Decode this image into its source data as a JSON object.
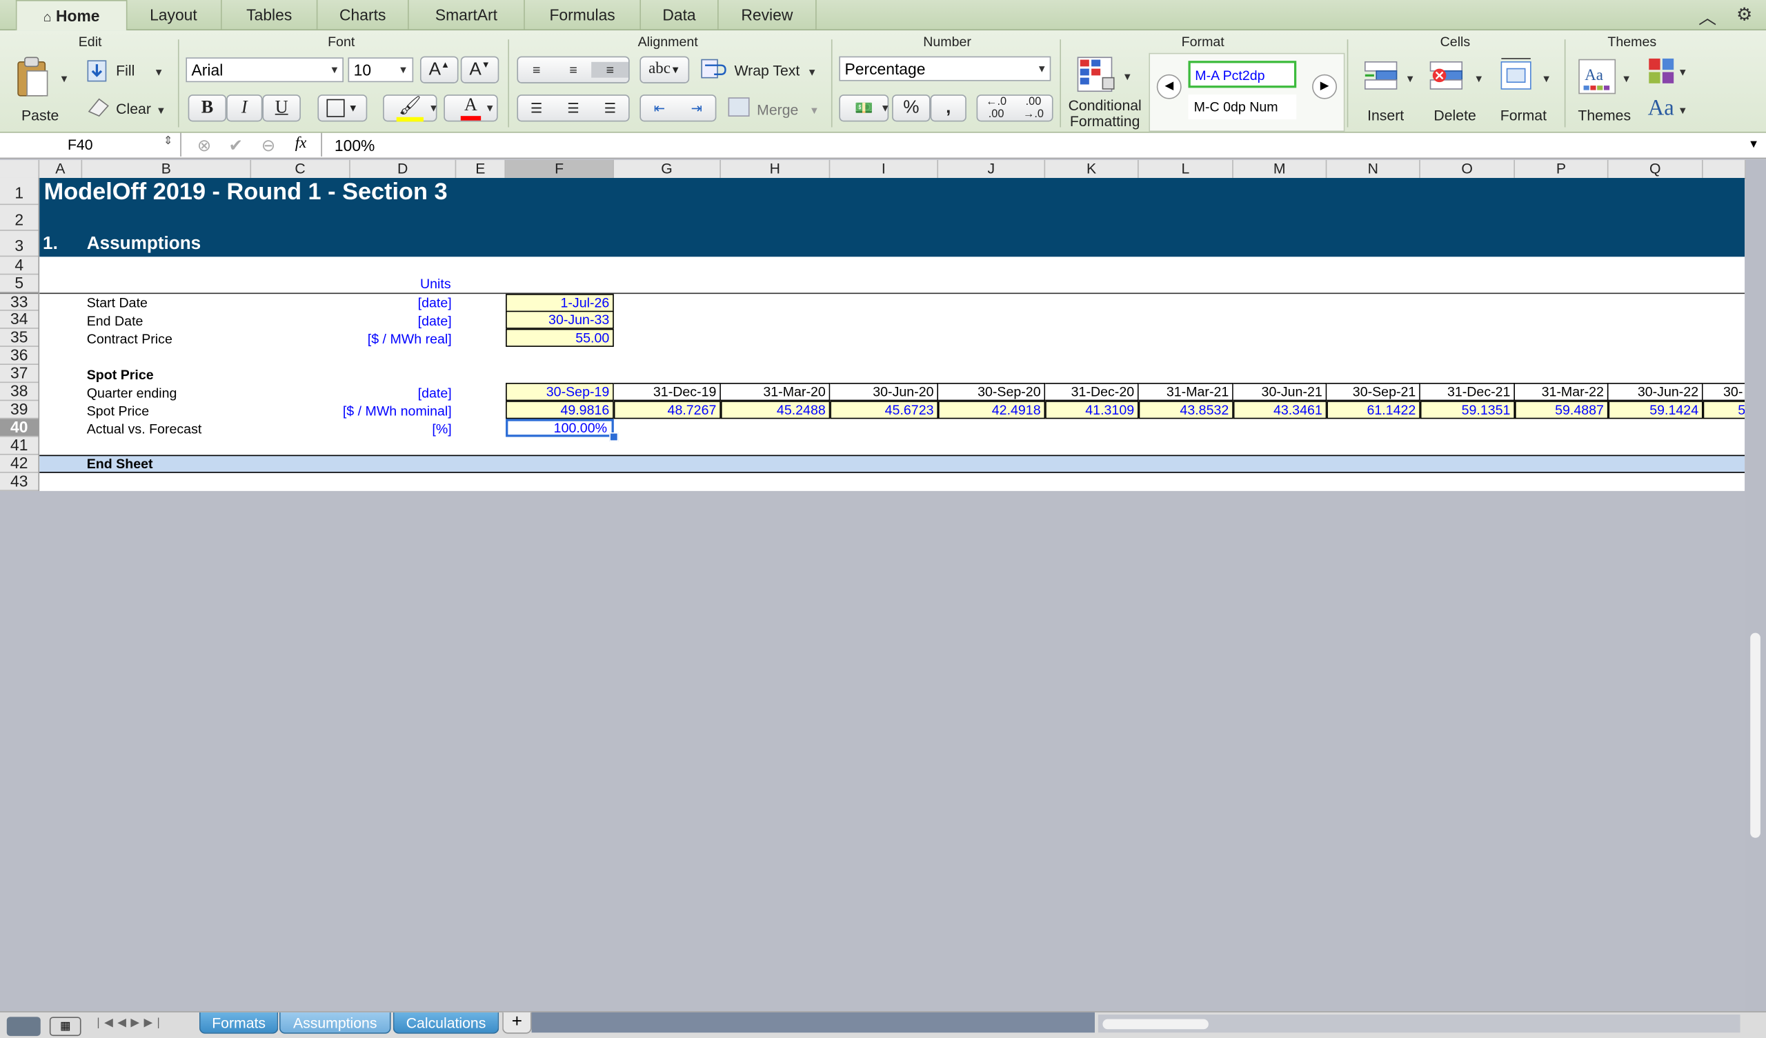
{
  "ribbon": {
    "tabs": [
      "Home",
      "Layout",
      "Tables",
      "Charts",
      "SmartArt",
      "Formulas",
      "Data",
      "Review"
    ],
    "groups": {
      "edit": {
        "title": "Edit",
        "paste": "Paste",
        "fill": "Fill",
        "clear": "Clear"
      },
      "font": {
        "title": "Font",
        "name": "Arial",
        "size": "10"
      },
      "alignment": {
        "title": "Alignment",
        "wrap": "Wrap Text",
        "merge": "Merge",
        "abc": "abc"
      },
      "number": {
        "title": "Number",
        "format": "Percentage"
      },
      "format": {
        "title": "Format",
        "conditional_line1": "Conditional",
        "conditional_line2": "Formatting",
        "style1": "M-A Pct2dp",
        "style2": "M-C 0dp Num"
      },
      "cells": {
        "title": "Cells",
        "insert": "Insert",
        "delete": "Delete",
        "format": "Format"
      },
      "themes": {
        "title": "Themes",
        "themes": "Themes",
        "aa": "Aa"
      }
    }
  },
  "formula_bar": {
    "name_box": "F40",
    "fx": "fx",
    "value": "100%"
  },
  "columns": [
    "A",
    "B",
    "C",
    "D",
    "E",
    "F",
    "G",
    "H",
    "I",
    "J",
    "K",
    "L",
    "M",
    "N",
    "O",
    "P",
    "Q"
  ],
  "rows": [
    "1",
    "2",
    "3",
    "4",
    "5",
    "33",
    "34",
    "35",
    "36",
    "37",
    "38",
    "39",
    "40",
    "41",
    "42",
    "43"
  ],
  "sheet": {
    "title": "ModelOff 2019 - Round 1 - Section 3",
    "section_num": "1.",
    "section_name": "Assumptions",
    "units_header": "Units",
    "start_date_label": "Start Date",
    "start_date_unit": "[date]",
    "start_date_value": "1-Jul-26",
    "end_date_label": "End Date",
    "end_date_unit": "[date]",
    "end_date_value": "30-Jun-33",
    "contract_price_label": "Contract Price",
    "contract_price_unit": "[$ / MWh real]",
    "contract_price_value": "55.00",
    "spot_header": "Spot Price",
    "quarter_label": "Quarter ending",
    "quarter_unit": "[date]",
    "spot_label": "Spot Price",
    "spot_unit": "[$ / MWh nominal]",
    "avf_label": "Actual vs. Forecast",
    "avf_unit": "[%]",
    "avf_value": "100.00%",
    "quarters": [
      "30-Sep-19",
      "31-Dec-19",
      "31-Mar-20",
      "30-Jun-20",
      "30-Sep-20",
      "31-Dec-20",
      "31-Mar-21",
      "30-Jun-21",
      "30-Sep-21",
      "31-Dec-21",
      "31-Mar-22",
      "30-Jun-22",
      "30-"
    ],
    "spot_prices": [
      "49.9816",
      "48.7267",
      "45.2488",
      "45.6723",
      "42.4918",
      "41.3109",
      "43.8532",
      "43.3461",
      "61.1422",
      "59.1351",
      "59.4887",
      "59.1424",
      "5"
    ],
    "end_sheet": "End Sheet"
  },
  "sheet_tabs": [
    "Formats",
    "Assumptions",
    "Calculations"
  ],
  "add_sheet": "+",
  "colors": {
    "banner": "#05466f",
    "input_fill": "#ffffcc",
    "end_band": "#c5d9f1",
    "input_text": "#0000ff"
  }
}
